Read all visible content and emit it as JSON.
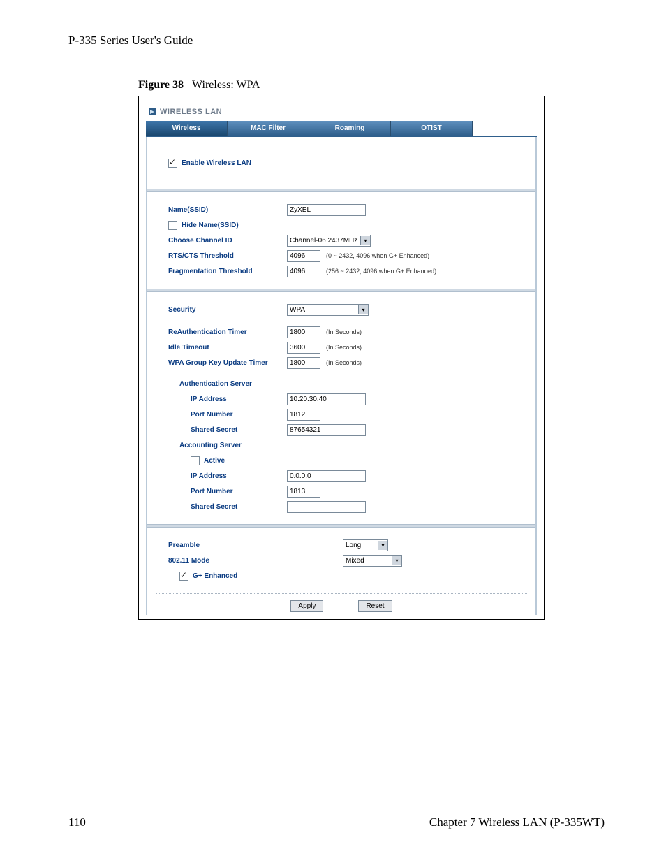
{
  "doc": {
    "header": "P-335 Series User's Guide",
    "figure_label": "Figure 38",
    "figure_title": "Wireless: WPA",
    "page_number": "110",
    "chapter": "Chapter 7 Wireless LAN (P-335WT)"
  },
  "ui": {
    "panel_title": "WIRELESS LAN",
    "tabs": {
      "wireless": "Wireless",
      "mac_filter": "MAC Filter",
      "roaming": "Roaming",
      "otist": "OTIST"
    },
    "enable_wlan_label": "Enable Wireless LAN",
    "enable_wlan_checked": true,
    "ssid": {
      "name_label": "Name(SSID)",
      "name_value": "ZyXEL",
      "hide_label": "Hide Name(SSID)",
      "hide_checked": false,
      "channel_label": "Choose Channel ID",
      "channel_value": "Channel-06 2437MHz",
      "rts_label": "RTS/CTS Threshold",
      "rts_value": "4096",
      "rts_hint": "(0 ~ 2432, 4096 when G+ Enhanced)",
      "frag_label": "Fragmentation Threshold",
      "frag_value": "4096",
      "frag_hint": "(256 ~ 2432, 4096 when G+ Enhanced)"
    },
    "sec": {
      "security_label": "Security",
      "security_value": "WPA",
      "reauth_label": "ReAuthentication Timer",
      "reauth_value": "1800",
      "idle_label": "Idle Timeout",
      "idle_value": "3600",
      "group_key_label": "WPA Group Key Update Timer",
      "group_key_value": "1800",
      "seconds_hint": "(In Seconds)",
      "auth_server_label": "Authentication Server",
      "auth_ip_label": "IP Address",
      "auth_ip_value": "10.20.30.40",
      "auth_port_label": "Port Number",
      "auth_port_value": "1812",
      "auth_secret_label": "Shared Secret",
      "auth_secret_value": "87654321",
      "acct_server_label": "Accounting Server",
      "acct_active_label": "Active",
      "acct_active_checked": false,
      "acct_ip_label": "IP Address",
      "acct_ip_value": "0.0.0.0",
      "acct_port_label": "Port Number",
      "acct_port_value": "1813",
      "acct_secret_label": "Shared Secret",
      "acct_secret_value": ""
    },
    "adv": {
      "preamble_label": "Preamble",
      "preamble_value": "Long",
      "mode_label": "802.11 Mode",
      "mode_value": "Mixed",
      "gplus_label": "G+ Enhanced",
      "gplus_checked": true
    },
    "buttons": {
      "apply": "Apply",
      "reset": "Reset"
    }
  }
}
